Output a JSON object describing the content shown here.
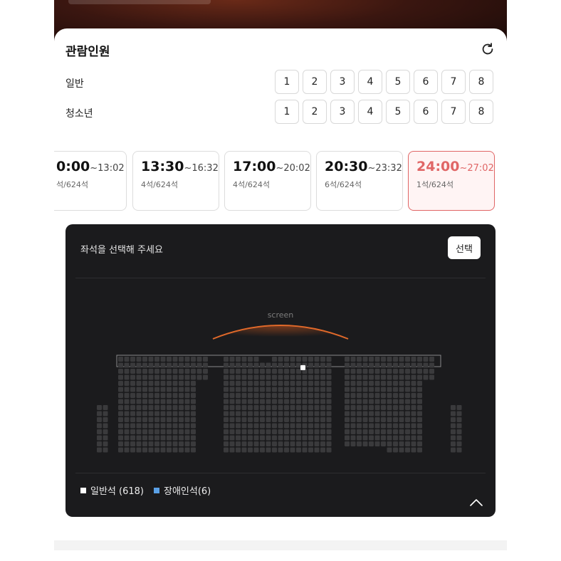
{
  "section": {
    "title": "관람인원"
  },
  "audience": {
    "general_label": "일반",
    "youth_label": "청소년",
    "general_counts": [
      "1",
      "2",
      "3",
      "4",
      "5",
      "6",
      "7",
      "8"
    ],
    "youth_counts": [
      "1",
      "2",
      "3",
      "4",
      "5",
      "6",
      "7",
      "8"
    ]
  },
  "showtimes": [
    {
      "start": "0:00",
      "end": "~13:02",
      "seats": "석/624석",
      "selected": false
    },
    {
      "start": "13:30",
      "end": "~16:32",
      "seats": "4석/624석",
      "selected": false
    },
    {
      "start": "17:00",
      "end": "~20:02",
      "seats": "4석/624석",
      "selected": false
    },
    {
      "start": "20:30",
      "end": "~23:32",
      "seats": "6석/624석",
      "selected": false
    },
    {
      "start": "24:00",
      "end": "~27:02",
      "seats": "1석/624석",
      "selected": true
    }
  ],
  "seat_panel": {
    "prompt": "좌석을 선택해 주세요",
    "select_label": "선택",
    "screen_label": "screen",
    "legend_general": "일반석 (618)",
    "legend_disabled": "장애인석(6)"
  },
  "colors": {
    "accent": "#e06666",
    "panel_bg": "#1b1b1d",
    "seat_taken": "#3a3a3c",
    "seat_available": "#ffffff",
    "seat_disabled": "#5aa0e6"
  },
  "icons": {
    "refresh": "refresh-icon",
    "collapse": "chevron-up-icon"
  }
}
